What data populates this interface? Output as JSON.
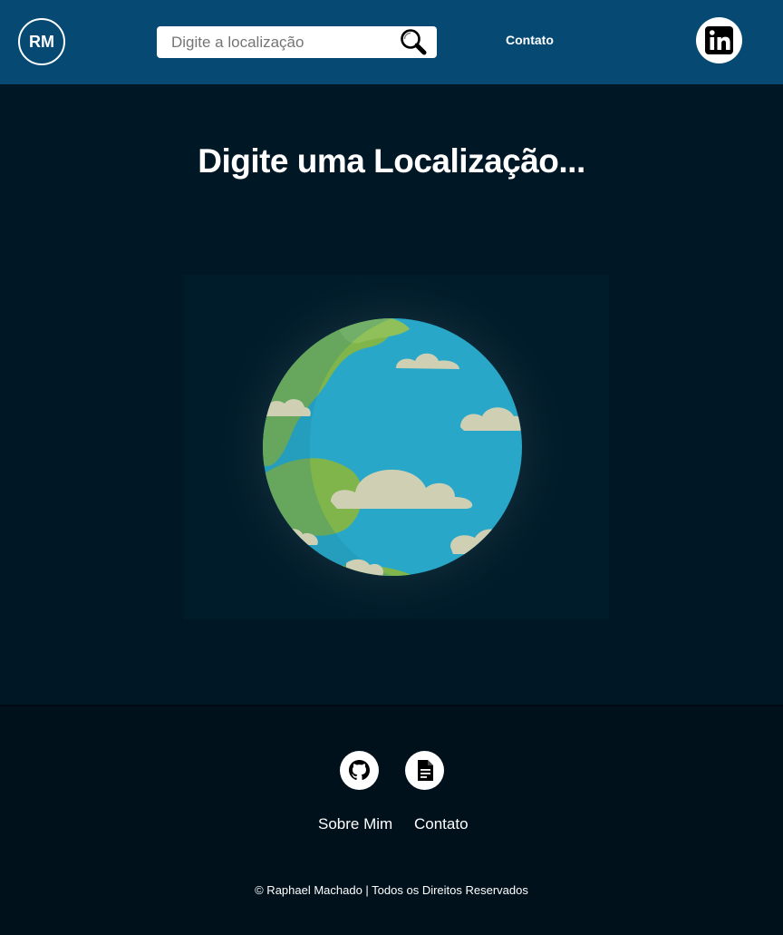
{
  "header": {
    "logo_text": "RM",
    "search": {
      "placeholder": "Digite a localização",
      "value": ""
    },
    "nav_contact_label": "Contato",
    "social_icon": "linkedin-icon"
  },
  "main": {
    "title": "Digite uma Localização...",
    "illustration": "globe-illustration"
  },
  "footer": {
    "icons": [
      "github-icon",
      "document-icon"
    ],
    "links": {
      "about": "Sobre Mim",
      "contact": "Contato"
    },
    "copyright": "© Raphael Machado | Todos os Direitos Reservados"
  },
  "colors": {
    "header_bg": "#064a73",
    "main_bg": "#001826",
    "footer_bg": "#00111b",
    "ocean": "#29a7c9",
    "land": "#7fb54a",
    "cloud": "#cfd0b3"
  }
}
